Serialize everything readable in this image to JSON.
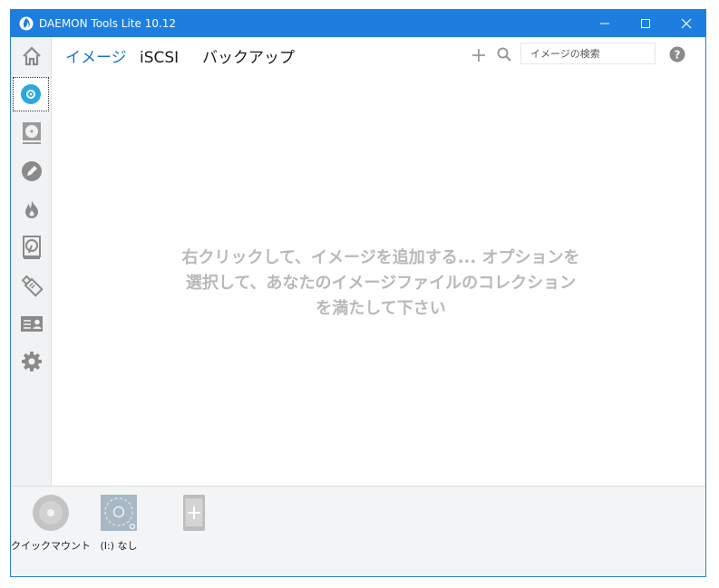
{
  "window": {
    "title": "DAEMON Tools Lite 10.12"
  },
  "sidebar": {
    "items": [
      {
        "icon": "home-icon"
      },
      {
        "icon": "disc-icon",
        "active": true
      },
      {
        "icon": "virtual-drive-icon"
      },
      {
        "icon": "edit-icon"
      },
      {
        "icon": "burn-icon"
      },
      {
        "icon": "hard-disk-icon"
      },
      {
        "icon": "usb-icon"
      },
      {
        "icon": "contact-card-icon"
      },
      {
        "icon": "gear-icon"
      }
    ]
  },
  "tabs": [
    {
      "label": "イメージ",
      "active": true
    },
    {
      "label": "iSCSI",
      "active": false
    },
    {
      "label": "バックアップ",
      "active": false
    }
  ],
  "search": {
    "placeholder": "イメージの検索"
  },
  "main": {
    "empty_message": "右クリックして、イメージを追加する... オプションを選択して、あなたのイメージファイルのコレクションを満たして下さい"
  },
  "devices": [
    {
      "label": "クイックマウント",
      "icon": "quick-mount-disc-icon"
    },
    {
      "label": "(I:) なし",
      "icon": "virtual-drive-icon"
    },
    {
      "label": "",
      "icon": "add-device-icon"
    }
  ],
  "colors": {
    "titlebar": "#1e7ee0",
    "accent": "#1a73c8",
    "active_icon": "#29a8e0",
    "icon_gray": "#8a8a8a"
  }
}
